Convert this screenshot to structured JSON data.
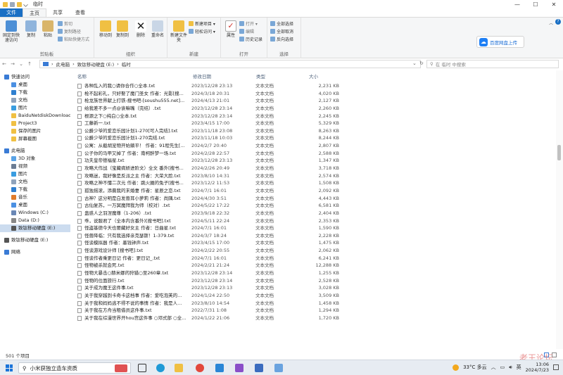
{
  "window": {
    "title": "临时",
    "min": "—",
    "max": "☐",
    "close": "✕"
  },
  "tabs": [
    "文件",
    "主页",
    "共享",
    "查看"
  ],
  "ribbon": {
    "clipboard": {
      "pin": "固定到快速访问",
      "copy": "复制",
      "paste": "粘贴",
      "cut": "剪切",
      "copy_path": "复制路径",
      "paste_shortcut": "粘贴快捷方式",
      "label": "剪贴板"
    },
    "organize": {
      "move": "移动到",
      "copy_to": "复制到",
      "delete": "删除",
      "rename": "重命名",
      "label": "组织"
    },
    "new": {
      "folder": "新建文件夹",
      "item": "新建项目 ▾",
      "easy": "轻松访问 ▾",
      "label": "新建"
    },
    "open": {
      "props": "属性",
      "open": "打开 ▾",
      "edit": "编辑",
      "history": "历史记录",
      "label": "打开"
    },
    "select": {
      "all": "全部选择",
      "none": "全部取消",
      "invert": "反向选择",
      "label": "选择"
    }
  },
  "cloud_button": "百度网盘上传",
  "path": [
    "此电脑",
    "致钛移动硬盘 (E:)",
    "临时"
  ],
  "search_placeholder": "在 临时 中搜索",
  "nav_items": [
    "快速访问",
    "桌面",
    "下载",
    "文档",
    "图片",
    "BaiduNetdiskDownload",
    "Project3",
    "保存的图片",
    "屏幕截图",
    "此电脑",
    "3D 对象",
    "视频",
    "图片",
    "文档",
    "下载",
    "音乐",
    "桌面",
    "Windows (C:)",
    "Data (D:)",
    "致钛移动硬盘 (E:)",
    "致钛移动硬盘 (E:)",
    "网络"
  ],
  "columns": {
    "name": "名称",
    "date": "修改日期",
    "type": "类型",
    "size": "大小"
  },
  "files": [
    {
      "n": "各种乱入的我○请你合作○全本.txt",
      "d": "2023/12/28 23:13",
      "t": "文本文档",
      "s": "2,231 KB"
    },
    {
      "n": "枪不起彩礼，只好娶了魔门圣女 作者：光影[搜...",
      "d": "2024/3/18 20:31",
      "t": "文本文档",
      "s": "4,020 KB"
    },
    {
      "n": "枪龙族世界献上打铁-搜书吧-[soushu555.net]...",
      "d": "2024/4/13 21:01",
      "t": "文本文档",
      "s": "2,127 KB"
    },
    {
      "n": "给我差不多一点@诶嘛嘴（完结）.txt",
      "d": "2023/12/28 23:14",
      "t": "文本文档",
      "s": "2,260 KB"
    },
    {
      "n": "根源之下○纯白○全本.txt",
      "d": "2023/12/28 23:14",
      "t": "文本文档",
      "s": "2,245 KB"
    },
    {
      "n": "工藤新一.txt",
      "d": "2023/4/15 17:00",
      "t": "文本文档",
      "s": "5,329 KB"
    },
    {
      "n": "公爵少爷的爱恋乐园计划1-270[可人完结].txt",
      "d": "2023/11/18 23:08",
      "t": "文本文档",
      "s": "8,263 KB"
    },
    {
      "n": "公爵少爷的爱恋乐园计划1-270完结.txt",
      "d": "2023/11/18 10:03",
      "t": "文本文档",
      "s": "8,244 KB"
    },
    {
      "n": "公寓：从截胡宠物开始躺平！ 作者：91程先生[...",
      "d": "2024/2/7 20:40",
      "t": "文本文档",
      "s": "2,807 KB"
    },
    {
      "n": "公子你的马甲又掉了 作者：南柯醉梦一场.txt",
      "d": "2024/2/28 22:57",
      "t": "文本文档",
      "s": "2,588 KB"
    },
    {
      "n": "功夫皇帝德福星.txt",
      "d": "2023/12/28 23:13",
      "t": "文本文档",
      "s": "1,347 KB"
    },
    {
      "n": "攻略大作战（宝藏病娇进阶文）全文 番外[搜书...",
      "d": "2024/2/26 20:49",
      "t": "文本文档",
      "s": "3,718 KB"
    },
    {
      "n": "攻略迷，我好像是反派之主 作者：大荣大脸.txt",
      "d": "2023/8/10 14:31",
      "t": "文本文档",
      "s": "2,574 KB"
    },
    {
      "n": "攻略之神不懂二次元 作者：跳火圈的兔子[搜书...",
      "d": "2023/12/2 11:53",
      "t": "文本文档",
      "s": "1,508 KB"
    },
    {
      "n": "孤独摇滚，添晨我的末婚妻 作者：星辰之恋.txt",
      "d": "2024/7/1 16:01",
      "t": "文本文档",
      "s": "2,092 KB"
    },
    {
      "n": "古神？这分明是白发兽耳小萝莉 作者：尚隅.txt",
      "d": "2024/4/30 3:51",
      "t": "文本文档",
      "s": "4,443 KB"
    },
    {
      "n": "古仙复苏，一万冥魔拜我为师（校对）.txt",
      "d": "2024/5/22 17:22",
      "t": "文本文档",
      "s": "6,581 KB"
    },
    {
      "n": "蛊惑人之羽涅魔尊（1-206）.txt",
      "d": "2023/9/18 22:32",
      "t": "文本文档",
      "s": "2,404 KB"
    },
    {
      "n": "乖，说服君了（全本内含番外)[搜书吧].txt",
      "d": "2024/5/11 22:24",
      "t": "文本文档",
      "s": "2,353 KB"
    },
    {
      "n": "怪盗基德今天也要藏好女主 作者：日曲星.txt",
      "d": "2024/7/1 16:01",
      "t": "文本文档",
      "s": "1,590 KB"
    },
    {
      "n": "怪兽降临：只有我选择亲克瑟斯！1-379.txt",
      "d": "2024/3/7 18:24",
      "t": "文本文档",
      "s": "2,228 KB"
    },
    {
      "n": "怪谈模拟器 作者：墨钱钟声.txt",
      "d": "2023/4/15 17:00",
      "t": "文本文档",
      "s": "1,475 KB"
    },
    {
      "n": "怪谈游戏设计师 [搜书吧].txt",
      "d": "2024/2/22 20:55",
      "t": "文本文档",
      "s": "2,062 KB"
    },
    {
      "n": "怪谈作者乘更日记 作者：更日记_.txt",
      "d": "2024/7/1 16:01",
      "t": "文本文档",
      "s": "6,241 KB"
    },
    {
      "n": "怪物被杀就会死.txt",
      "d": "2024/2/21 21:24",
      "t": "文本文档",
      "s": "12,288 KB"
    },
    {
      "n": "怪物大暴击○赫米娜的狩猎○至260章.txt",
      "d": "2023/12/28 23:14",
      "t": "文本文档",
      "s": "1,255 KB"
    },
    {
      "n": "怪物的位面旅行.txt",
      "d": "2023/12/28 23:14",
      "t": "文本文档",
      "s": "2,528 KB"
    },
    {
      "n": "关于成为魔王这件事.txt",
      "d": "2023/12/28 23:13",
      "t": "文本文档",
      "s": "3,028 KB"
    },
    {
      "n": "关于我穿越到卡奇卡这档事 作者：爱吃泡芙的...",
      "d": "2024/1/24 22:50",
      "t": "文本文档",
      "s": "3,509 KB"
    },
    {
      "n": "关于我和妈妈逃不得不说的事情 作者：我是人...",
      "d": "2023/8/10 14:54",
      "t": "文本文档",
      "s": "1,458 KB"
    },
    {
      "n": "关于我在方舟当租借员这件事.txt",
      "d": "2022/7/31 1:08",
      "t": "文本文档",
      "s": "1,294 KB"
    },
    {
      "n": "关于我在综漫世界开hou宫这件事 ○邓式部 ○全...",
      "d": "2024/1/22 21:06",
      "t": "文本文档",
      "s": "1,720 KB"
    }
  ],
  "status": "501 个项目",
  "taskbar": {
    "search": "小米获独立造车资质",
    "weather": "33°C 多云",
    "lang": "英",
    "time": "13:06",
    "date": "2024/7/23"
  },
  "watermark": "老王论坛",
  "colors": {
    "accent": "#1a6fc4",
    "selection": "#ccdcef"
  }
}
